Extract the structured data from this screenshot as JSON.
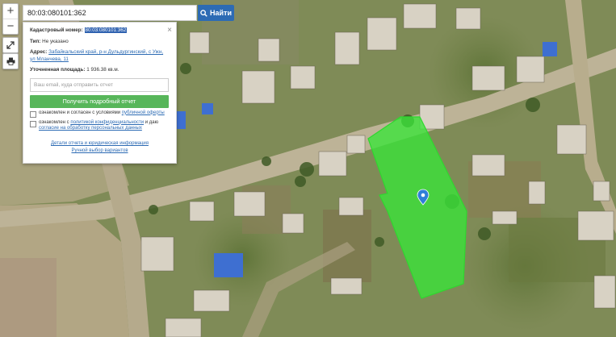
{
  "map": {
    "zoom_in_label": "+",
    "zoom_out_label": "−",
    "parcel_color": "#39e639",
    "marker_color": "#2f7fd8"
  },
  "search": {
    "value": "80:03:080101:362",
    "button_label": "Найти",
    "button_icon": "search-icon",
    "accent": "#2d6bb4"
  },
  "card": {
    "cadastral_label": "Кадастровый номер:",
    "cadastral_value": "80:03:080101:362",
    "type_label": "Тип:",
    "type_value": "Не указано",
    "address_label": "Адрес:",
    "address_value": "Забайкальский край, р-н Дульдургинский, с Ужн, ул Мланчева, 11",
    "area_label": "Уточненная площадь:",
    "area_value": "1 936.38 кв.м.",
    "email_placeholder": "Ваш email, куда отправить отчет",
    "get_report_button": "Получить подробный отчет",
    "get_report_color": "#57b65a",
    "consent1_text": "ознакомлен и согласен с условиями",
    "consent1_link": "публичной оферты",
    "consent2_text": "ознакомлен с",
    "consent2_link": "политикой конфиденциальности",
    "consent2_suffix": "и даю",
    "consent2_link2": "согласие на обработку персональных данных",
    "details_link": "Детали отчета и юридическая информация",
    "manual_link": "Ручной выбор вариантов"
  }
}
